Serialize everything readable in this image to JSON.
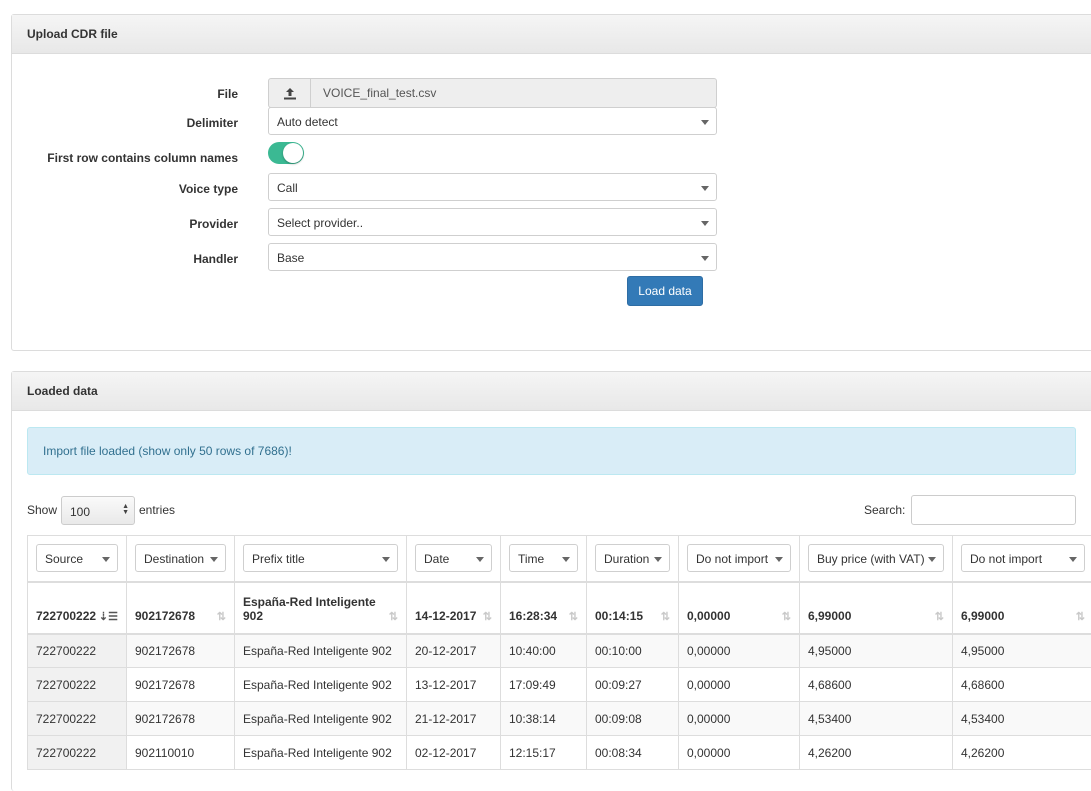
{
  "upload": {
    "title": "Upload CDR file",
    "file_label": "File",
    "file_name": "VOICE_final_test.csv",
    "delimiter_label": "Delimiter",
    "delimiter_value": "Auto detect",
    "first_row_label": "First row contains column names",
    "first_row_enabled": true,
    "voice_type_label": "Voice type",
    "voice_type_value": "Call",
    "provider_label": "Provider",
    "provider_value": "Select provider..",
    "handler_label": "Handler",
    "handler_value": "Base",
    "load_button": "Load data"
  },
  "loaded": {
    "title": "Loaded data",
    "alert": "Import file loaded (show only 50 rows of 7686)!",
    "show_label": "Show",
    "page_length": "100",
    "entries_label": "entries",
    "search_label": "Search:"
  },
  "table": {
    "filters": [
      "Source",
      "Destination",
      "Prefix title",
      "Date",
      "Time",
      "Duration",
      "Do not import",
      "Buy price (with VAT)",
      "Do not import"
    ],
    "header_row": [
      "722700222",
      "902172678",
      "España-Red Inteligente 902",
      "14-12-2017",
      "16:28:34",
      "00:14:15",
      "0,00000",
      "6,99000",
      "6,99000"
    ],
    "rows": [
      [
        "722700222",
        "902172678",
        "España-Red Inteligente 902",
        "20-12-2017",
        "10:40:00",
        "00:10:00",
        "0,00000",
        "4,95000",
        "4,95000"
      ],
      [
        "722700222",
        "902172678",
        "España-Red Inteligente 902",
        "13-12-2017",
        "17:09:49",
        "00:09:27",
        "0,00000",
        "4,68600",
        "4,68600"
      ],
      [
        "722700222",
        "902172678",
        "España-Red Inteligente 902",
        "21-12-2017",
        "10:38:14",
        "00:09:08",
        "0,00000",
        "4,53400",
        "4,53400"
      ],
      [
        "722700222",
        "902110010",
        "España-Red Inteligente 902",
        "02-12-2017",
        "12:15:17",
        "00:08:34",
        "0,00000",
        "4,26200",
        "4,26200"
      ]
    ]
  },
  "icons": {
    "upload": "upload-icon",
    "sort_active": "sort-amount-asc-icon",
    "sort": "sort-icon"
  },
  "colors": {
    "primary": "#337ab7",
    "toggle_on": "#3bb993",
    "alert_bg": "#d9edf7",
    "alert_text": "#31708f"
  }
}
